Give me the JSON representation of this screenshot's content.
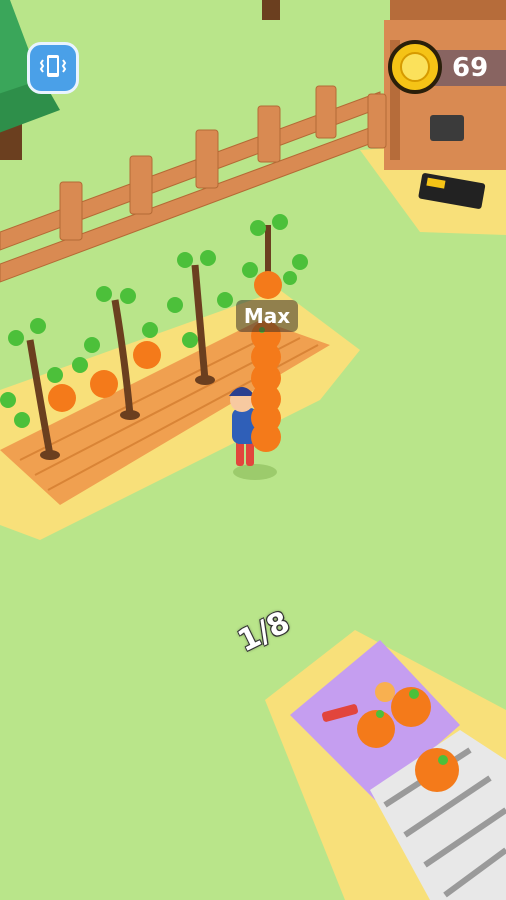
{
  "hud": {
    "vibration_icon": "phone-vibrate-icon",
    "coin_icon": "coin-icon",
    "coin_count": "69"
  },
  "carry_label": "Max",
  "delivery_progress": "1/8",
  "colors": {
    "grass": "#b9e58a",
    "sand": "#f8e07a",
    "soil": "#f0a050",
    "fence": "#d98a52",
    "orange": "#f47a1a",
    "leaf": "#4cc03a",
    "mat": "#c59ef0"
  },
  "fruit_stack_count": 6
}
